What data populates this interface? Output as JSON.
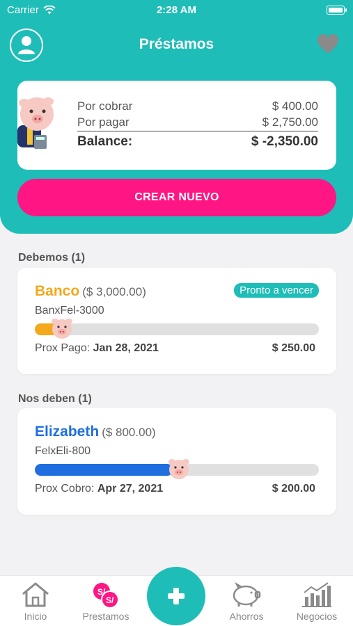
{
  "status_bar": {
    "carrier": "Carrier",
    "time": "2:28 AM"
  },
  "header": {
    "title": "Préstamos"
  },
  "summary": {
    "por_cobrar_label": "Por cobrar",
    "por_cobrar_value": "$ 400.00",
    "por_pagar_label": "Por pagar",
    "por_pagar_value": "$ 2,750.00",
    "balance_label": "Balance:",
    "balance_value": "$ -2,350.00"
  },
  "create_button": "CREAR NUEVO",
  "sections": {
    "debemos": "Debemos (1)",
    "nos_deben": "Nos deben (1)"
  },
  "loans": [
    {
      "name": "Banco",
      "amount": "($ 3,000.00)",
      "badge": "Pronto a vencer",
      "code": "BanxFel-3000",
      "progress": 0.08,
      "due_label": "Prox Pago:",
      "due_date": "Jan 28, 2021",
      "payment": "$ 250.00",
      "color": "#f4a81c"
    },
    {
      "name": "Elizabeth",
      "amount": "($ 800.00)",
      "code": "FelxEli-800",
      "progress": 0.48,
      "due_label": "Prox Cobro:",
      "due_date": "Apr 27, 2021",
      "payment": "$ 200.00",
      "color": "#1f6fe0"
    }
  ],
  "tabbar": {
    "inicio": "Inicio",
    "prestamos": "Prestamos",
    "ahorros": "Ahorros",
    "negocios": "Negocios",
    "prestamos_badge_1": "S/",
    "prestamos_badge_2": "S/"
  },
  "colors": {
    "primary": "#1ebdb7",
    "accent": "#ff1583"
  }
}
